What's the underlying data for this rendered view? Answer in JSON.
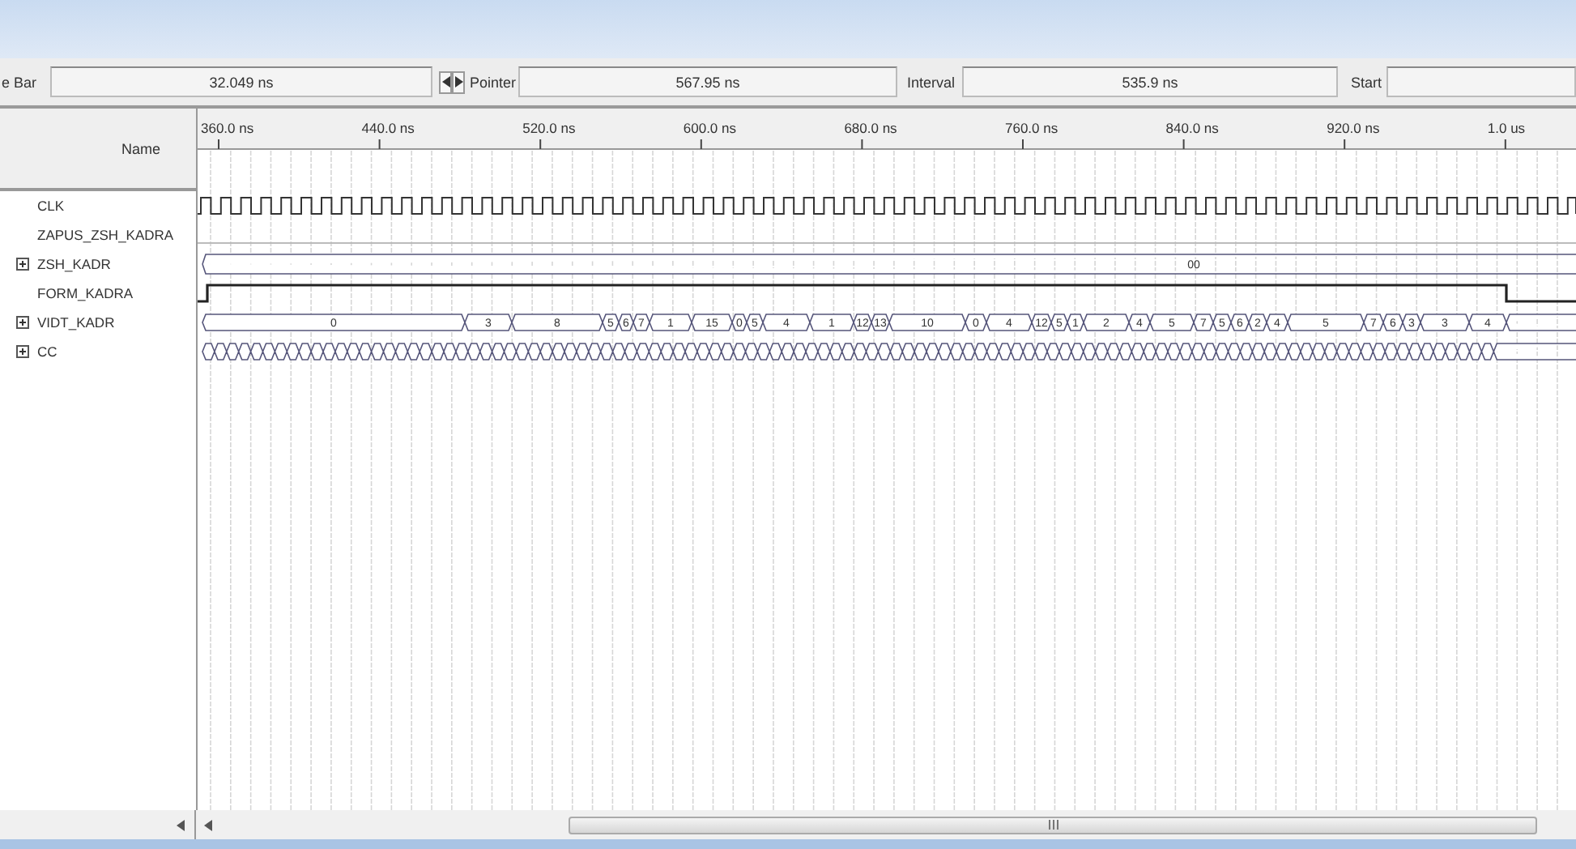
{
  "toolbar": {
    "time_bar": {
      "label": "e Bar",
      "value": "32.049 ns"
    },
    "pointer": {
      "label": "Pointer",
      "value": "567.95 ns"
    },
    "interval": {
      "label": "Interval",
      "value": "535.9 ns"
    },
    "start": {
      "label": "Start"
    }
  },
  "ruler": {
    "ticks": [
      "360.0 ns",
      "440.0 ns",
      "520.0 ns",
      "600.0 ns",
      "680.0 ns",
      "760.0 ns",
      "840.0 ns",
      "920.0 ns",
      "1.0 us"
    ]
  },
  "name_column": {
    "header": "Name"
  },
  "signals": [
    {
      "name": "CLK",
      "kind": "clock"
    },
    {
      "name": "ZAPUS_ZSH_KADRA",
      "kind": "bit"
    },
    {
      "name": "ZSH_KADR",
      "kind": "bus",
      "expanded": false,
      "values": [
        "00"
      ]
    },
    {
      "name": "FORM_KADRA",
      "kind": "bit"
    },
    {
      "name": "VIDT_KADR",
      "kind": "bus",
      "expanded": false,
      "values": [
        "0",
        "3",
        "8",
        "5",
        "6",
        "7",
        "1",
        "15",
        "0",
        "5",
        "4",
        "1",
        "12",
        "13",
        "10",
        "0",
        "4",
        "12",
        "5",
        "1",
        "2",
        "4",
        "5",
        "7",
        "5",
        "6",
        "2",
        "4",
        "5",
        "7",
        "6",
        "3",
        "3",
        "4"
      ]
    },
    {
      "name": "CC",
      "kind": "bus",
      "expanded": false
    }
  ]
}
